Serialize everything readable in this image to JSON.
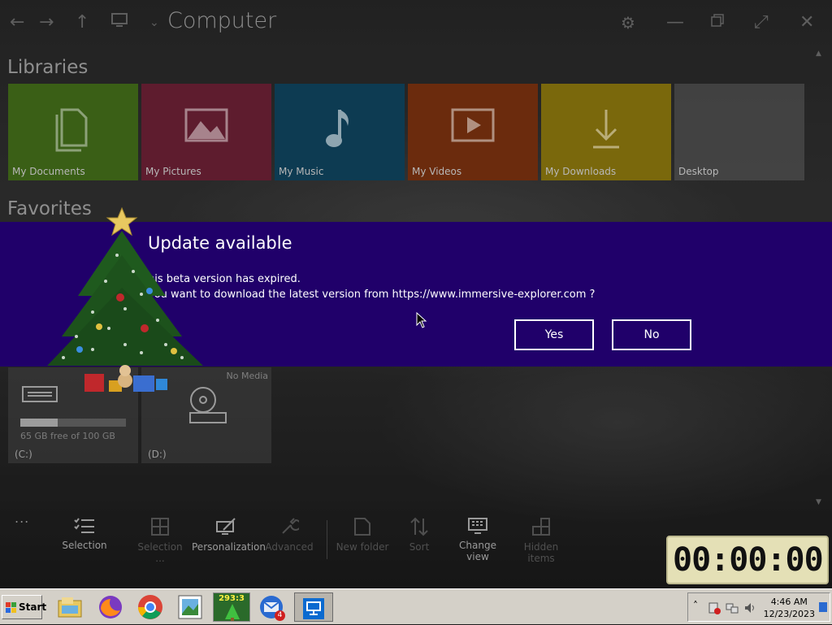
{
  "window": {
    "title": "Computer",
    "sections": {
      "libraries": "Libraries",
      "favorites": "Favorites"
    }
  },
  "libraries": [
    {
      "label": "My Documents",
      "icon": "documents-icon",
      "color": "#3a5f16"
    },
    {
      "label": "My Pictures",
      "icon": "pictures-icon",
      "color": "#5e1c2e"
    },
    {
      "label": "My Music",
      "icon": "music-icon",
      "color": "#0d3b52"
    },
    {
      "label": "My Videos",
      "icon": "videos-icon",
      "color": "#6b2b0d"
    },
    {
      "label": "My Downloads",
      "icon": "downloads-icon",
      "color": "#7a680c"
    },
    {
      "label": "Desktop",
      "icon": "",
      "color": "#4a4a4a"
    }
  ],
  "drives": [
    {
      "label": "(C:)",
      "free_text": "65 GB free of 100 GB",
      "used_fraction": 0.35
    },
    {
      "label": "(D:)",
      "status": "No Media"
    }
  ],
  "toolbar": [
    {
      "label": "Selection",
      "enabled": true
    },
    {
      "label": "Selection ...",
      "enabled": false
    },
    {
      "label": "Personalization",
      "enabled": true
    },
    {
      "label": "Advanced",
      "enabled": false
    },
    {
      "label": "New folder",
      "enabled": false
    },
    {
      "label": "Sort",
      "enabled": false
    },
    {
      "label": "Change view",
      "enabled": true
    },
    {
      "label": "Hidden items",
      "enabled": false
    }
  ],
  "more_label": "...",
  "dialog": {
    "title": "Update available",
    "line1": "his beta version has expired.",
    "line2": "you want to download the latest version from https://www.immersive-explorer.com ?",
    "yes_label": "Yes",
    "no_label": "No",
    "background": "#20006a"
  },
  "clock_widget": {
    "time": "00:00:00"
  },
  "taskbar": {
    "start_label": "Start",
    "apps": [
      "file-manager-icon",
      "firefox-icon",
      "chrome-icon",
      "image-viewer-icon",
      "christmas-tree-app-icon",
      "thunderbird-icon",
      "immersive-explorer-icon"
    ],
    "tree_app_counter": "293:3",
    "mail_badge": "4",
    "clock_time": "4:46 AM",
    "clock_date": "12/23/2023"
  }
}
